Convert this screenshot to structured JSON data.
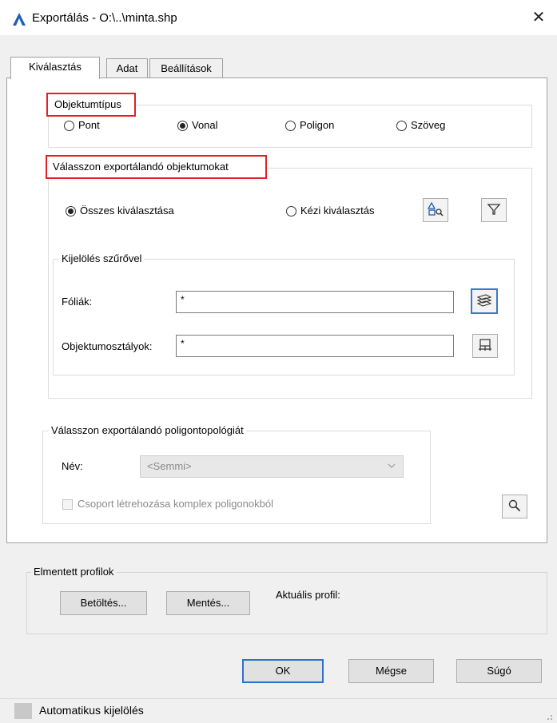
{
  "window": {
    "title": "Exportálás - O:\\..\\minta.shp",
    "close_glyph": "✕"
  },
  "tabs": [
    {
      "label": "Kiválasztás",
      "active": true
    },
    {
      "label": "Adat",
      "active": false
    },
    {
      "label": "Beállítások",
      "active": false
    }
  ],
  "object_type": {
    "title": "Objektumtípus",
    "options": [
      {
        "label": "Pont",
        "selected": false
      },
      {
        "label": "Vonal",
        "selected": true
      },
      {
        "label": "Poligon",
        "selected": false
      },
      {
        "label": "Szöveg",
        "selected": false
      }
    ]
  },
  "select_objects": {
    "title": "Válasszon exportálandó objektumokat",
    "select_all_label": "Összes kiválasztása",
    "select_all_selected": true,
    "manual_label": "Kézi kiválasztás",
    "manual_selected": false,
    "filter": {
      "title": "Kijelölés szűrővel",
      "layers_label": "Fóliák:",
      "layers_value": "*",
      "classes_label": "Objektumosztályok:",
      "classes_value": "*"
    }
  },
  "topology": {
    "title": "Válasszon exportálandó poligontopológiát",
    "name_label": "Név:",
    "name_value": "<Semmi>",
    "checkbox_label": "Csoport létrehozása komplex poligonokból",
    "checkbox_checked": false
  },
  "profiles": {
    "title": "Elmentett profilok",
    "load_label": "Betöltés...",
    "save_label": "Mentés...",
    "current_label": "Aktuális profil:"
  },
  "buttons": {
    "ok": "OK",
    "cancel": "Mégse",
    "help": "Súgó"
  },
  "status": {
    "text": "Automatikus kijelölés"
  },
  "colors": {
    "highlight_red": "#e0202a",
    "accent_blue": "#2f6fd0",
    "app_icon_blue": "#1f5fb4"
  },
  "icons": [
    "app-logo-icon",
    "close-icon",
    "quick-select-icon",
    "filter-funnel-icon",
    "layers-icon",
    "object-classes-icon",
    "magnify-icon",
    "dropdown-chevron-icon"
  ]
}
